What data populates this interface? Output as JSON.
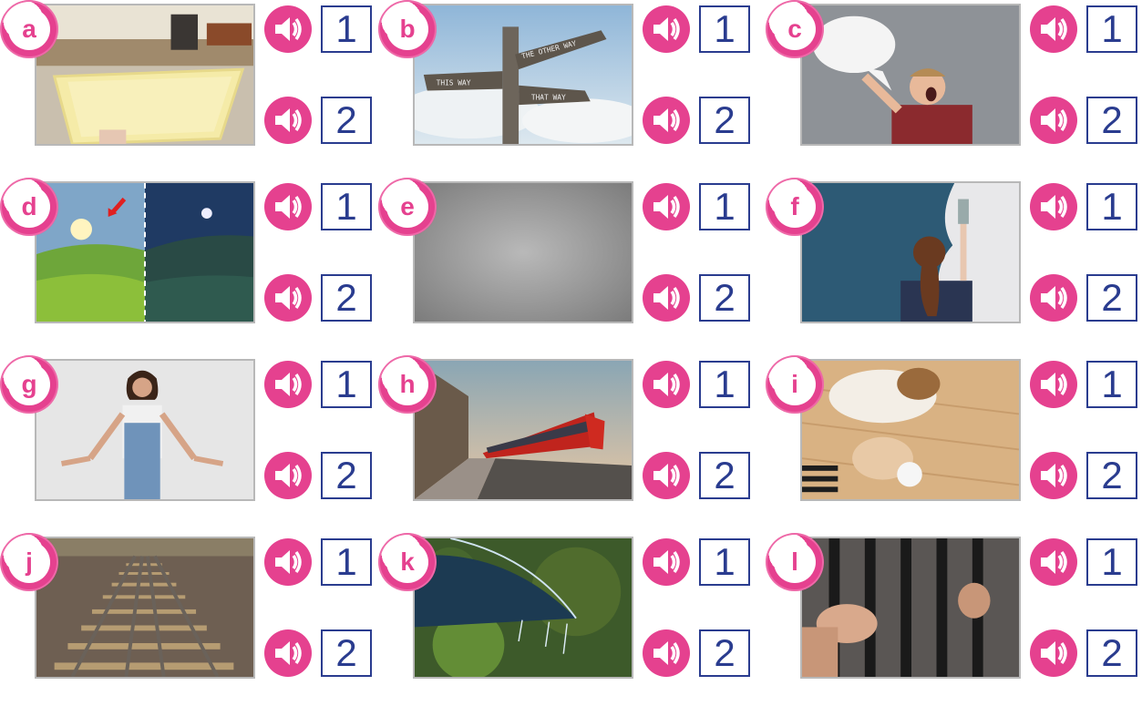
{
  "cards": [
    {
      "letter": "a",
      "opt1": "1",
      "opt2": "2",
      "img": "tray-icon"
    },
    {
      "letter": "b",
      "opt1": "1",
      "opt2": "2",
      "img": "signpost-icon",
      "sign_labels": [
        "THE OTHER WAY",
        "THIS WAY",
        "THAT WAY"
      ]
    },
    {
      "letter": "c",
      "opt1": "1",
      "opt2": "2",
      "img": "shouting-man-icon"
    },
    {
      "letter": "d",
      "opt1": "1",
      "opt2": "2",
      "img": "day-night-icon"
    },
    {
      "letter": "e",
      "opt1": "1",
      "opt2": "2",
      "img": "grey-gradient-icon"
    },
    {
      "letter": "f",
      "opt1": "1",
      "opt2": "2",
      "img": "painting-wall-icon"
    },
    {
      "letter": "g",
      "opt1": "1",
      "opt2": "2",
      "img": "shrugging-girl-icon"
    },
    {
      "letter": "h",
      "opt1": "1",
      "opt2": "2",
      "img": "red-train-icon"
    },
    {
      "letter": "i",
      "opt1": "1",
      "opt2": "2",
      "img": "dog-paw-icon"
    },
    {
      "letter": "j",
      "opt1": "1",
      "opt2": "2",
      "img": "rail-tracks-icon"
    },
    {
      "letter": "k",
      "opt1": "1",
      "opt2": "2",
      "img": "umbrella-rain-icon"
    },
    {
      "letter": "l",
      "opt1": "1",
      "opt2": "2",
      "img": "prison-bars-icon"
    }
  ],
  "colors": {
    "accent": "#e5418f",
    "box": "#2a3c8f",
    "frame": "#b8b8b8"
  }
}
